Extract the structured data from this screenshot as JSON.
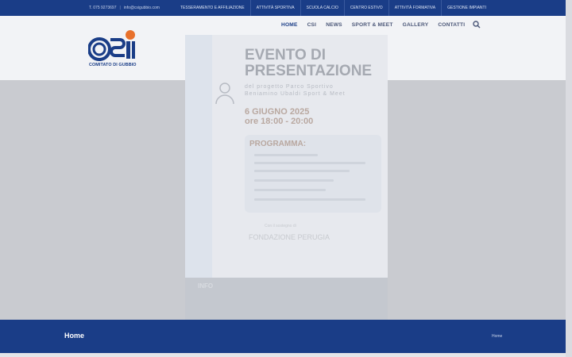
{
  "topbar": {
    "phone": "T. 075 9273697",
    "email": "info@csigubbio.com",
    "nav": [
      "TESSERAMENTO E AFFILIAZIONE",
      "ATTIVITÀ SPORTIVA",
      "SCUOLA CALCIO",
      "CENTRO ESTIVO",
      "ATTIVITÀ FORMATIVA",
      "GESTIONE IMPIANTI"
    ]
  },
  "header": {
    "logo_text": "COMITATO DI GUBBIO",
    "nav": [
      "HOME",
      "CSI",
      "NEWS",
      "SPORT & MEET",
      "GALLERY",
      "CONTATTI"
    ],
    "active": "HOME",
    "search_icon": "search-icon"
  },
  "poster": {
    "title_line1": "EVENTO DI",
    "title_line2": "PRESENTAZIONE",
    "subtitle_line1": "del progetto Parco Sportivo",
    "subtitle_line2": "Beniamino Ubaldi Sport & Meet",
    "date_line1": "6 GIUGNO 2025",
    "date_line2": "ore 18:00 - 20:00",
    "program_title": "PROGRAMMA:",
    "collab": "Con il sostegno di",
    "foundation": "FONDAZIONE PERUGIA",
    "info_title": "INFO"
  },
  "page": {
    "title": "Home",
    "breadcrumb": "Home"
  },
  "colors": {
    "brand_blue": "#1a3d87",
    "accent_orange": "#e8712c"
  }
}
